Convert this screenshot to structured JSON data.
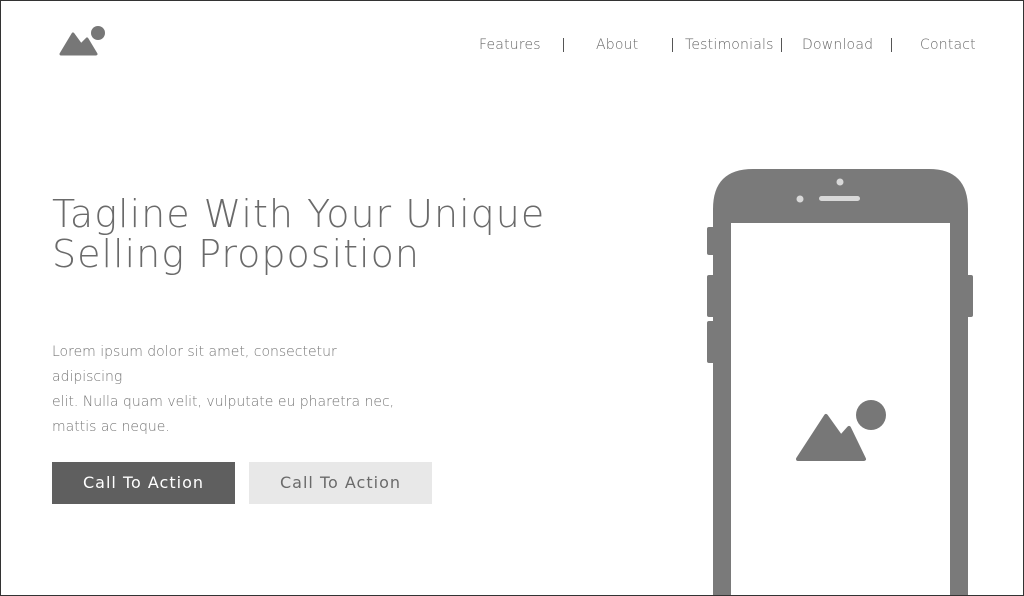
{
  "nav": {
    "items": [
      "Features",
      "About",
      "Testimonials",
      "Download",
      "Contact"
    ]
  },
  "hero": {
    "tagline_line1": "Tagline With Your Unique",
    "tagline_line2": "Selling Proposition",
    "body_line1": "Lorem ipsum dolor sit amet, consectetur adipiscing",
    "body_line2": "elit. Nulla quam velit, vulputate eu pharetra nec,",
    "body_line3": "mattis ac neque.",
    "cta_primary": "Call To Action",
    "cta_secondary": "Call To Action"
  },
  "icons": {
    "logo": "image-placeholder-icon",
    "phone_screen": "image-placeholder-icon"
  },
  "colors": {
    "primary_button": "#5f5f5f",
    "secondary_button": "#e8e8e8",
    "device": "#7a7a7a",
    "text": "#6a6a6a"
  }
}
